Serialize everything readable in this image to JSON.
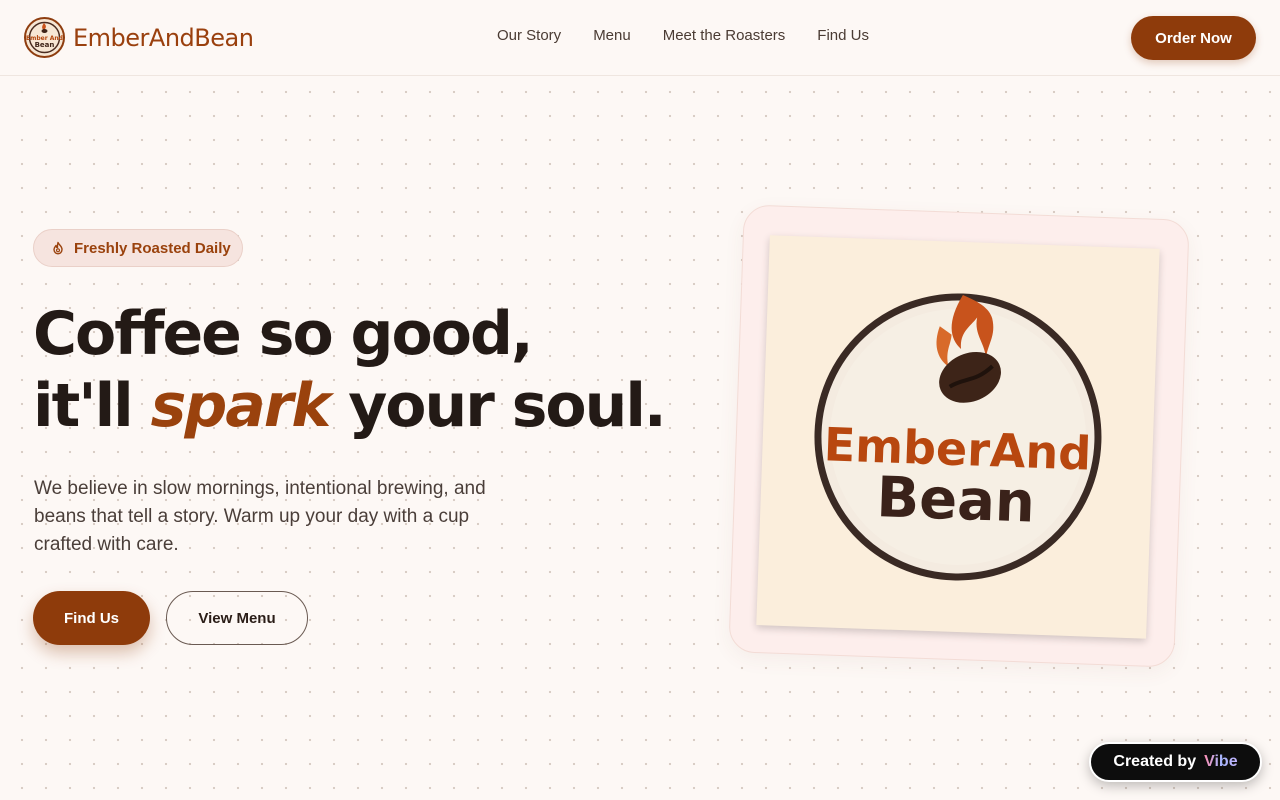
{
  "brand": {
    "name": "EmberAndBean",
    "logo_text_line1": "Ember And",
    "logo_text_line2": "Bean"
  },
  "nav": {
    "links": [
      "Our Story",
      "Menu",
      "Meet the Roasters",
      "Find Us"
    ],
    "cta": "Order Now"
  },
  "hero": {
    "badge_icon": "flame-icon",
    "badge": "Freshly Roasted Daily",
    "headline_line1": "Coffee so good,",
    "headline_line2_start": "it'll",
    "headline_accent": "spark",
    "headline_line2_end": "your soul.",
    "lede": "We believe in slow mornings, intentional brewing, and beans that tell a story. Warm up your day with a cup crafted with care.",
    "primary_button": "Find Us",
    "secondary_button": "View Menu"
  },
  "logo_card": {
    "line1": "EmberAnd",
    "line2": "Bean"
  },
  "created_badge": {
    "label": "Created by",
    "brand": "Vibe"
  },
  "colors": {
    "accent": "#8e3b0b",
    "background": "#fdf8f5",
    "badge_bg": "#f6e4df",
    "text_dark": "#231a16"
  }
}
